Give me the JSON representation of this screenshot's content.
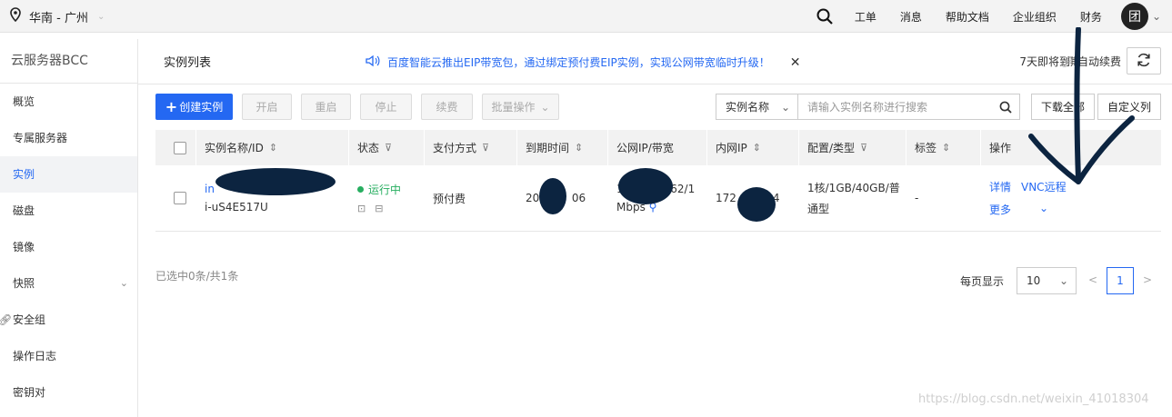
{
  "topbar": {
    "region": "华南 - 广州",
    "nav": [
      "工单",
      "消息",
      "帮助文档",
      "企业组织",
      "财务"
    ],
    "avatar_text": "团"
  },
  "sidebar": {
    "title": "云服务器BCC",
    "items": [
      {
        "label": "概览"
      },
      {
        "label": "专属服务器"
      },
      {
        "label": "实例",
        "active": true
      },
      {
        "label": "磁盘"
      },
      {
        "label": "镜像"
      },
      {
        "label": "快照",
        "has_chevron": true
      },
      {
        "label": "安全组"
      },
      {
        "label": "操作日志"
      },
      {
        "label": "密钥对"
      }
    ]
  },
  "page": {
    "title": "实例列表",
    "notice": "百度智能云推出EIP带宽包，通过绑定预付费EIP实例，实现公网带宽临时升级！",
    "expire_label": "7天即将到期",
    "auto_renew_label": "自动续费"
  },
  "toolbar": {
    "create": "创建实例",
    "start": "开启",
    "restart": "重启",
    "stop": "停止",
    "renew": "续费",
    "batch": "批量操作",
    "search_field": "实例名称",
    "search_placeholder": "请输入实例名称进行搜索",
    "download_all": "下载全部",
    "custom_columns": "自定义列"
  },
  "table": {
    "headers": [
      "实例名称/ID",
      "状态",
      "支付方式",
      "到期时间",
      "公网IP/带宽",
      "内网IP",
      "配置/类型",
      "标签",
      "操作"
    ],
    "rows": [
      {
        "name_prefix": "in",
        "id": "i-uS4E517U",
        "status": "运行中",
        "payment": "预付费",
        "expire_prefix": "201",
        "expire_suffix": "06",
        "public_ip_prefix": "18",
        "public_ip_suffix": "62/1",
        "bandwidth": "Mbps",
        "private_ip_prefix": "172",
        "private_ip_suffix": "4",
        "config_line1": "1核/1GB/40GB/普",
        "config_line2": "通型",
        "tag": "-",
        "op_detail": "详情",
        "op_vnc": "VNC远程",
        "op_more": "更多"
      }
    ]
  },
  "footer": {
    "selected_info": "已选中0条/共1条",
    "page_size_label": "每页显示",
    "page_size": "10",
    "current_page": "1",
    "prev": "<",
    "next": ">"
  },
  "watermark": "https://blog.csdn.net/weixin_41018304",
  "colors": {
    "accent": "#2468f2",
    "status_green": "#27ae60",
    "redaction": "#0c2440"
  }
}
